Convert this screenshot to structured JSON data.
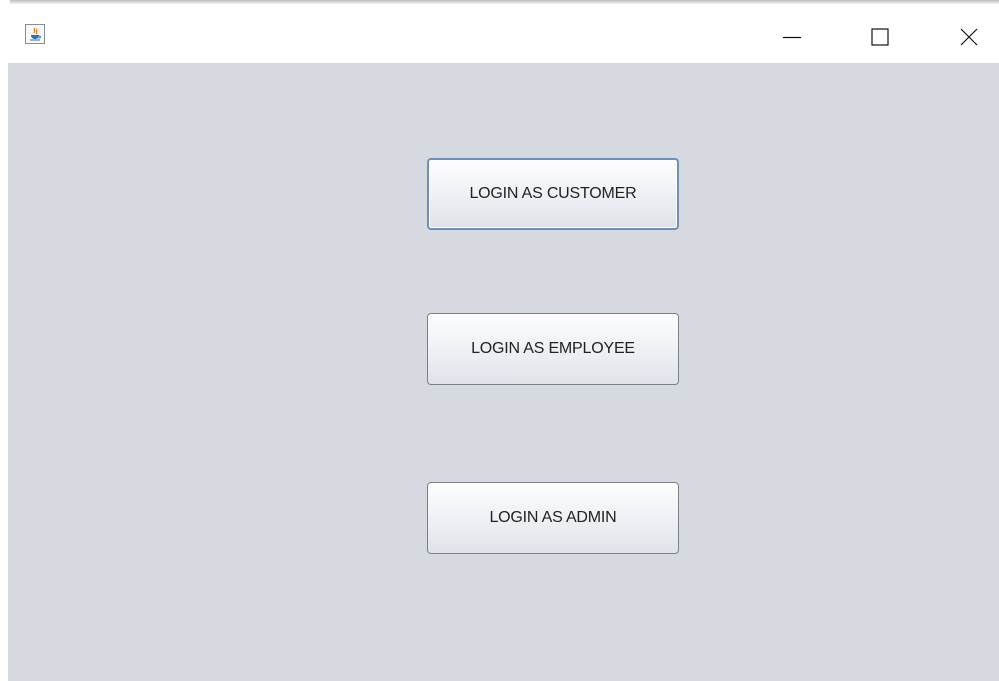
{
  "window": {
    "title": "",
    "icon": "java-icon",
    "controls": {
      "minimize_icon": "minimize-icon",
      "maximize_icon": "maximize-icon",
      "close_icon": "close-icon"
    }
  },
  "buttons": {
    "customer": "LOGIN AS CUSTOMER",
    "employee": "LOGIN AS EMPLOYEE",
    "admin": "LOGIN AS ADMIN"
  },
  "colors": {
    "content_background": "#d6d9e0",
    "button_text": "#222222",
    "focus_border": "#6f8fb8"
  }
}
